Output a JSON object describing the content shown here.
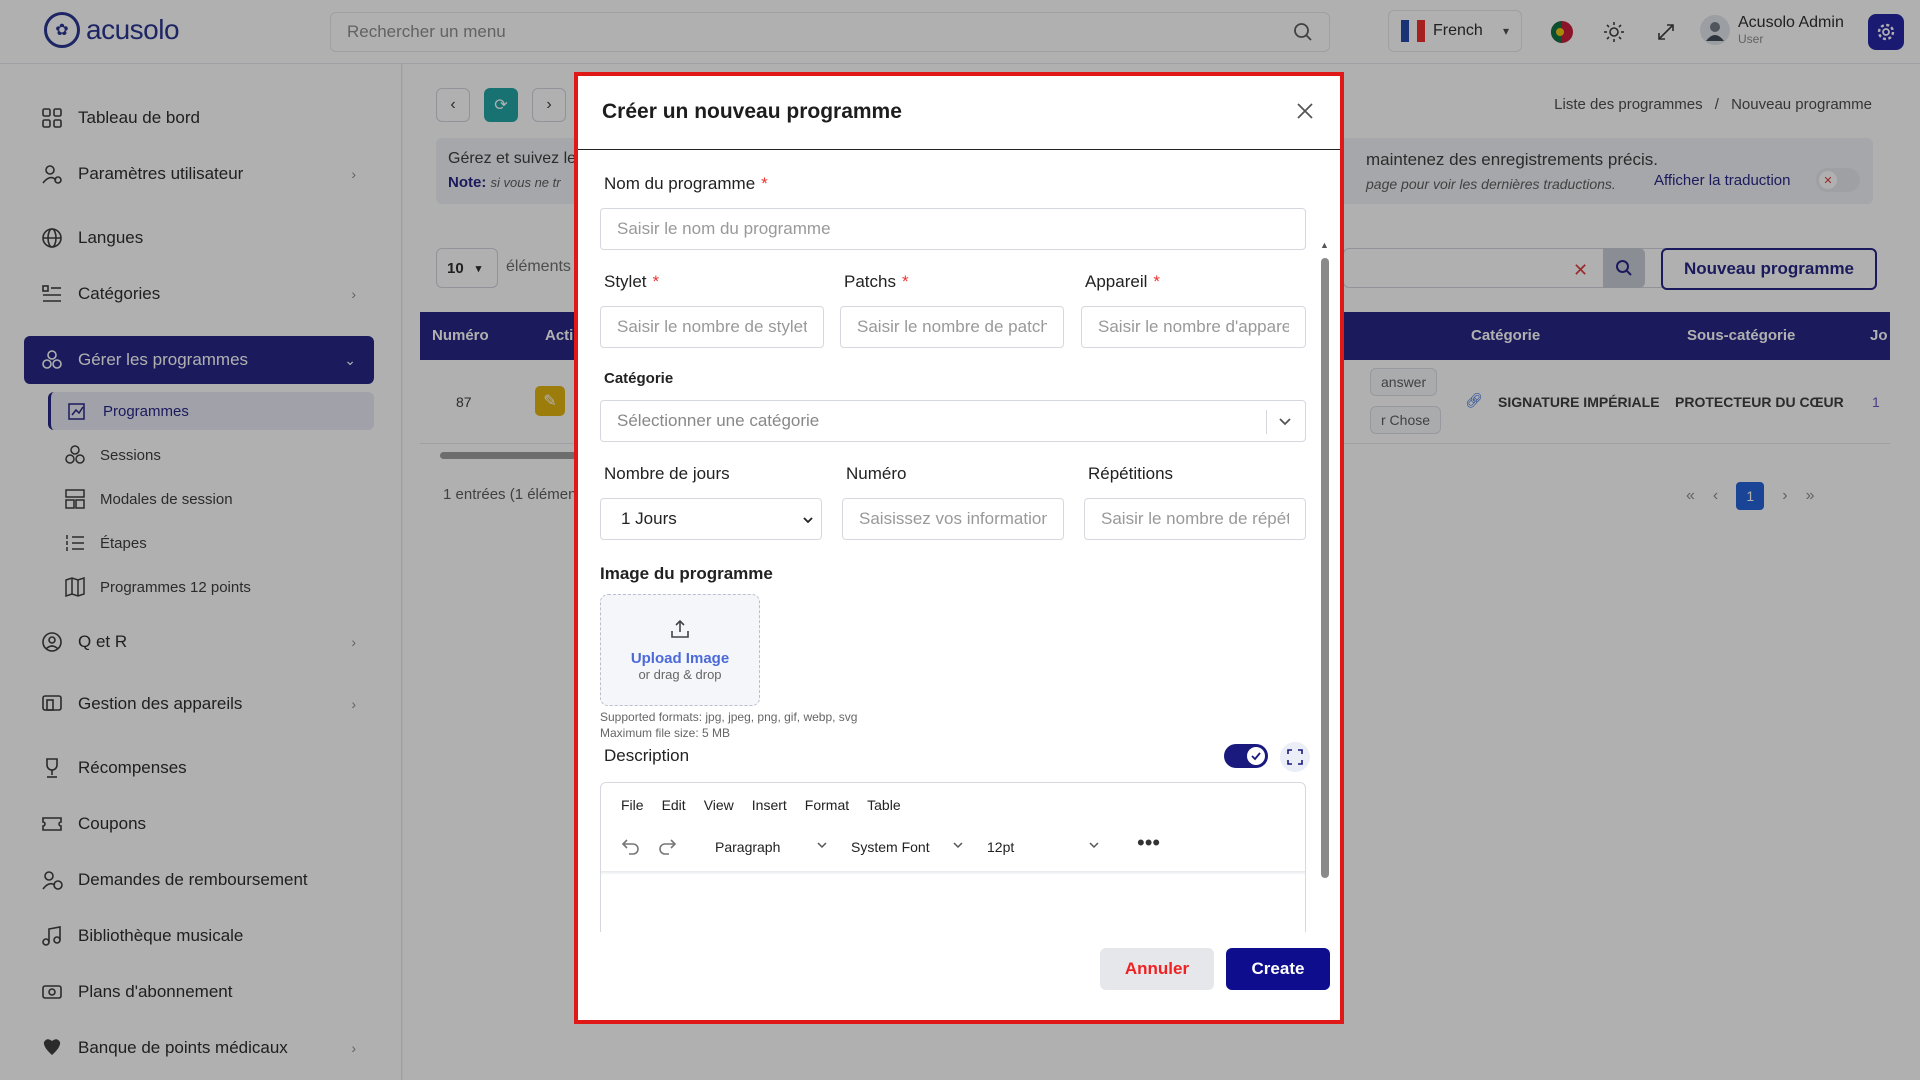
{
  "header": {
    "logo_text": "acusolo",
    "search_placeholder": "Rechercher un menu",
    "language": "French",
    "user_name": "Acusolo Admin",
    "user_role": "User"
  },
  "sidebar": {
    "items": [
      {
        "label": "Tableau de bord",
        "icon": "grid-icon"
      },
      {
        "label": "Paramètres utilisateur",
        "icon": "user-gear-icon"
      },
      {
        "label": "Langues",
        "icon": "globe-icon"
      },
      {
        "label": "Catégories",
        "icon": "list-icon"
      },
      {
        "label": "Gérer les programmes",
        "icon": "program-icon"
      },
      {
        "label": "Q et R",
        "icon": "qa-icon"
      },
      {
        "label": "Gestion des appareils",
        "icon": "device-icon"
      },
      {
        "label": "Récompenses",
        "icon": "trophy-icon"
      },
      {
        "label": "Coupons",
        "icon": "coupon-icon"
      },
      {
        "label": "Demandes de remboursement",
        "icon": "refund-icon"
      },
      {
        "label": "Bibliothèque musicale",
        "icon": "music-icon"
      },
      {
        "label": "Plans d'abonnement",
        "icon": "subscription-icon"
      },
      {
        "label": "Banque de points médicaux",
        "icon": "medical-icon"
      }
    ],
    "sub_items": [
      {
        "label": "Programmes"
      },
      {
        "label": "Sessions"
      },
      {
        "label": "Modales de session"
      },
      {
        "label": "Étapes"
      },
      {
        "label": "Programmes 12 points"
      }
    ]
  },
  "main": {
    "breadcrumb_1": "Liste des programmes",
    "breadcrumb_sep": "/",
    "breadcrumb_2": "Nouveau programme",
    "info_left": "Gérez et suivez le",
    "info_right": "maintenez des enregistrements précis.",
    "note_label": "Note:",
    "note_left": "si vous ne tr",
    "note_right": "page pour voir les dernières traductions.",
    "show_translation": "Afficher la traduction",
    "per_page": "10",
    "per_page_label": "éléments",
    "new_button": "Nouveau programme",
    "table_headers": {
      "numero": "Numéro",
      "actions": "Acti",
      "categorie": "Catégorie",
      "sous_categorie": "Sous-catégorie",
      "jours": "Jo"
    },
    "row": {
      "numero": "87",
      "pill1": "answer",
      "pill2": "r Chose",
      "categorie": "SIGNATURE IMPÉRIALE",
      "sous_categorie": "PROTECTEUR DU CŒUR",
      "jours": "1"
    },
    "entries": "1 entrées (1 élémen",
    "page": "1"
  },
  "modal": {
    "title": "Créer un nouveau programme",
    "name_label": "Nom du programme",
    "name_placeholder": "Saisir le nom du programme",
    "stylet_label": "Stylet",
    "stylet_placeholder": "Saisir le nombre de stylets",
    "patchs_label": "Patchs",
    "patchs_placeholder": "Saisir le nombre de patchs",
    "appareil_label": "Appareil",
    "appareil_placeholder": "Saisir le nombre d'appareils",
    "categorie_label": "Catégorie",
    "categorie_placeholder": "Sélectionner une catégorie",
    "days_label": "Nombre de jours",
    "days_value": "1 Jours",
    "numero_label": "Numéro",
    "numero_placeholder": "Saisissez vos informations",
    "repetitions_label": "Répétitions",
    "repetitions_placeholder": "Saisir le nombre de répétitions",
    "image_label": "Image du programme",
    "upload_main": "Upload Image",
    "upload_sub": "or drag & drop",
    "formats": "Supported formats: jpg, jpeg, png, gif, webp, svg",
    "max_size": "Maximum file size: 5 MB",
    "description_label": "Description",
    "editor_menu": [
      "File",
      "Edit",
      "View",
      "Insert",
      "Format",
      "Table"
    ],
    "editor_paragraph": "Paragraph",
    "editor_font": "System Font",
    "editor_size": "12pt",
    "cancel": "Annuler",
    "create": "Create",
    "required_mark": "*"
  },
  "colors": {
    "brand": "#1a1a7e",
    "highlight_border": "#e01818",
    "cancel_text": "#e22222"
  }
}
